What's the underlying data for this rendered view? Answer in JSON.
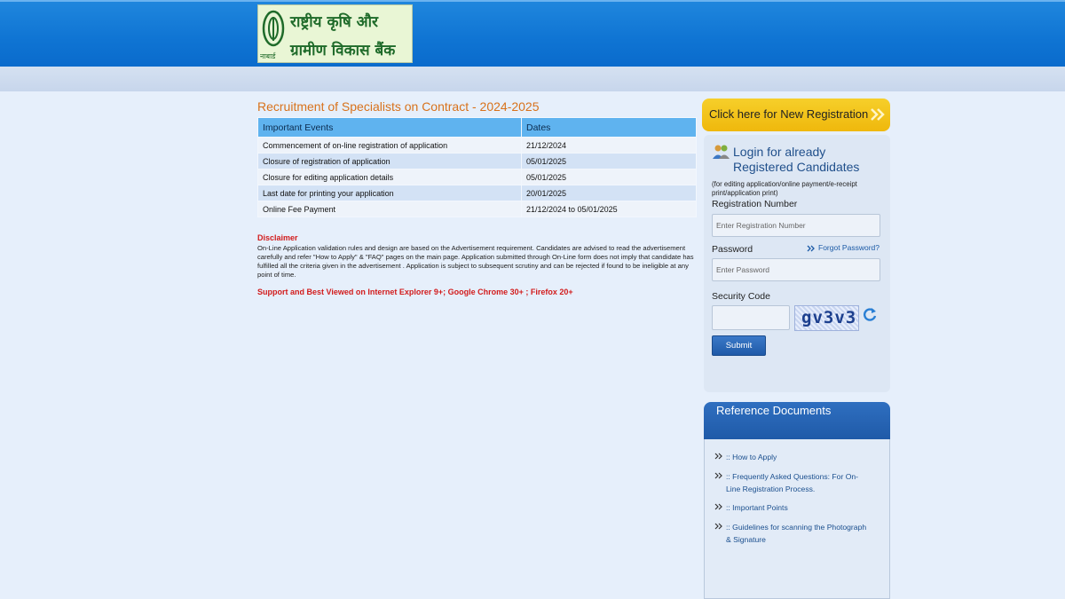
{
  "logo": {
    "line1": "राष्ट्रीय कृषि और",
    "line2": "ग्रामीण विकास बैंक",
    "small": "नाबार्ड"
  },
  "page": {
    "title": "Recruitment of Specialists on Contract - 2024-2025"
  },
  "events_table": {
    "headers": [
      "Important Events",
      "Dates"
    ],
    "rows": [
      {
        "event": "Commencement of on-line registration of application",
        "date": "21/12/2024"
      },
      {
        "event": "Closure of registration of application",
        "date": "05/01/2025"
      },
      {
        "event": "Closure for editing application details",
        "date": "05/01/2025"
      },
      {
        "event": "Last date for printing your application",
        "date": "20/01/2025"
      },
      {
        "event": "Online Fee Payment",
        "date": "21/12/2024 to 05/01/2025"
      }
    ]
  },
  "disclaimer": {
    "title": "Disclaimer",
    "text": "On-Line Application validation rules and design are based on the Advertisement requirement. Candidates are advised to read the advertisement carefully and refer \"How to Apply\" & \"FAQ\" pages on the main page. Application submitted through On-Line form does not imply that candidate has fulfilled all the criteria given in the advertisement . Application is subject to subsequent scrutiny and can be rejected if found to be ineligible at any point of time.",
    "support": "Support and Best Viewed on Internet Explorer 9+; Google Chrome 30+ ; Firefox 20+"
  },
  "new_registration": {
    "label": "Click here for New Registration"
  },
  "login": {
    "title": "Login for already Registered Candidates",
    "note": "(for editing application/online payment/e-receipt print/application print)",
    "registration_label": "Registration Number",
    "registration_placeholder": "Enter Registration Number",
    "password_label": "Password",
    "password_placeholder": "Enter Password",
    "forgot_label": "Forgot Password?",
    "security_label": "Security Code",
    "captcha_text": "gv3v3",
    "submit_label": "Submit"
  },
  "reference": {
    "title": "Reference Documents",
    "items": [
      ":: How to Apply",
      ":: Frequently Asked Questions: For On-Line Registration Process.",
      ":: Important Points",
      ":: Guidelines for scanning the Photograph & Signature"
    ]
  },
  "colors": {
    "header_blue": "#0f74d3",
    "title_orange": "#d8721c",
    "table_header": "#5fb3ef",
    "alert_red": "#d21c1c",
    "registration_yellow": "#efb80c",
    "panel_blue": "#1f5aa8"
  }
}
